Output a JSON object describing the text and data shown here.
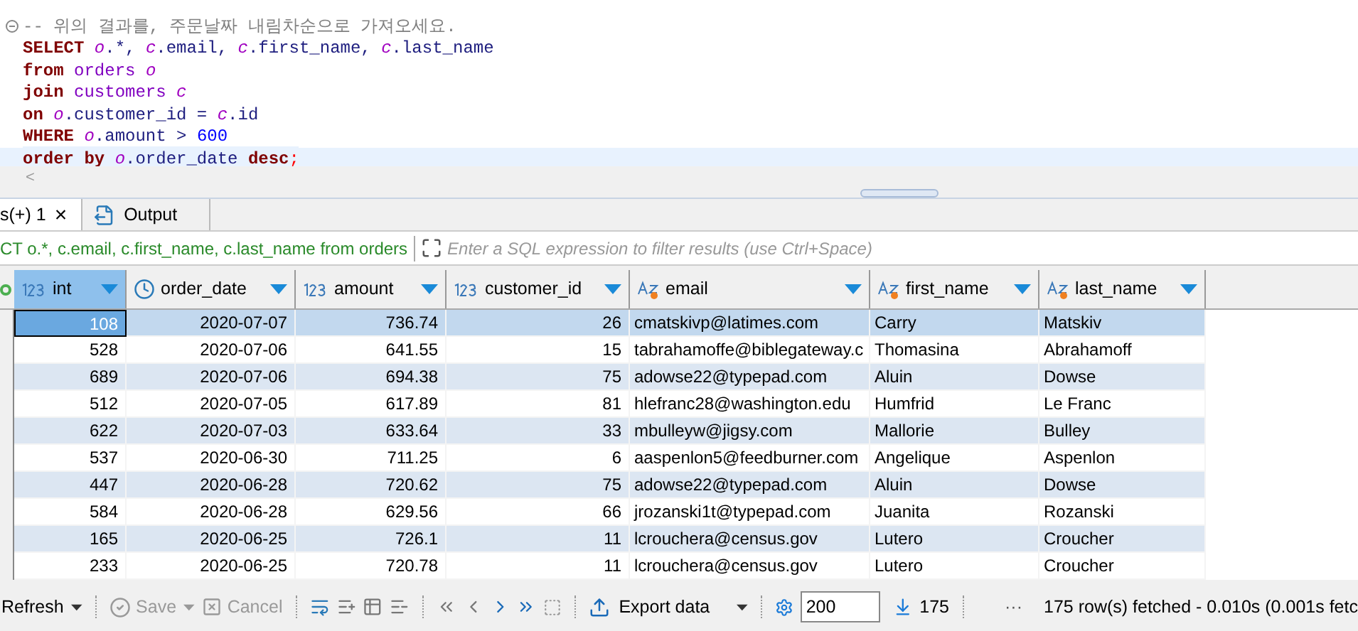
{
  "editor": {
    "lines": [
      {
        "current": false,
        "collapsible": true,
        "tokens": [
          {
            "kind": "comment",
            "text": "-- 위의 결과를, 주문날짜 내림차순으로 가져오세요."
          }
        ]
      },
      {
        "current": false,
        "collapsible": false,
        "tokens": [
          {
            "kind": "keyword",
            "text": "SELECT "
          },
          {
            "kind": "alias",
            "text": "o"
          },
          {
            "kind": "plain",
            "text": ".*, "
          },
          {
            "kind": "alias",
            "text": "c"
          },
          {
            "kind": "plain",
            "text": ".email, "
          },
          {
            "kind": "alias",
            "text": "c"
          },
          {
            "kind": "plain",
            "text": ".first_name, "
          },
          {
            "kind": "alias",
            "text": "c"
          },
          {
            "kind": "plain",
            "text": ".last_name"
          }
        ]
      },
      {
        "current": false,
        "collapsible": false,
        "tokens": [
          {
            "kind": "keyword",
            "text": "from "
          },
          {
            "kind": "table",
            "text": "orders "
          },
          {
            "kind": "alias",
            "text": "o"
          }
        ]
      },
      {
        "current": false,
        "collapsible": false,
        "tokens": [
          {
            "kind": "keyword",
            "text": "join "
          },
          {
            "kind": "table",
            "text": "customers "
          },
          {
            "kind": "alias",
            "text": "c"
          }
        ]
      },
      {
        "current": false,
        "collapsible": false,
        "tokens": [
          {
            "kind": "keyword",
            "text": "on "
          },
          {
            "kind": "alias",
            "text": "o"
          },
          {
            "kind": "plain",
            "text": ".customer_id = "
          },
          {
            "kind": "alias",
            "text": "c"
          },
          {
            "kind": "plain",
            "text": ".id"
          }
        ]
      },
      {
        "current": false,
        "collapsible": false,
        "tokens": [
          {
            "kind": "keyword",
            "text": "WHERE "
          },
          {
            "kind": "alias",
            "text": "o"
          },
          {
            "kind": "plain",
            "text": ".amount > "
          },
          {
            "kind": "number",
            "text": "600"
          }
        ]
      },
      {
        "current": true,
        "collapsible": false,
        "tokens": [
          {
            "kind": "keyword",
            "text": "order by "
          },
          {
            "kind": "alias",
            "text": "o"
          },
          {
            "kind": "plain",
            "text": ".order_date "
          },
          {
            "kind": "keyword",
            "text": "desc"
          },
          {
            "kind": "punct",
            "text": ";"
          }
        ]
      }
    ],
    "scroll_left": "<"
  },
  "tabs": [
    {
      "label": "s(+) 1",
      "close": "×",
      "selected": true,
      "kind": "results"
    },
    {
      "label": "Output",
      "selected": false,
      "kind": "output"
    }
  ],
  "filter": {
    "query": "CT o.*, c.email, c.first_name, c.last_name from orders",
    "placeholder": "Enter a SQL expression to filter results (use Ctrl+Space)"
  },
  "table": {
    "columns": [
      {
        "label": "int",
        "kind": "number",
        "selected": true
      },
      {
        "label": "order_date",
        "kind": "date",
        "selected": false
      },
      {
        "label": "amount",
        "kind": "number",
        "selected": false
      },
      {
        "label": "customer_id",
        "kind": "number",
        "selected": false
      },
      {
        "label": "email",
        "kind": "text",
        "selected": false
      },
      {
        "label": "first_name",
        "kind": "text",
        "selected": false
      },
      {
        "label": "last_name",
        "kind": "text",
        "selected": false
      }
    ],
    "rows": [
      {
        "selected": true,
        "cells": [
          "108",
          "2020-07-07",
          "736.74",
          "26",
          "cmatskivp@latimes.com",
          "Carry",
          "Matskiv"
        ]
      },
      {
        "selected": false,
        "cells": [
          "528",
          "2020-07-06",
          "641.55",
          "15",
          "tabrahamoffe@biblegateway.c",
          "Thomasina",
          "Abrahamoff"
        ]
      },
      {
        "selected": false,
        "cells": [
          "689",
          "2020-07-06",
          "694.38",
          "75",
          "adowse22@typepad.com",
          "Aluin",
          "Dowse"
        ]
      },
      {
        "selected": false,
        "cells": [
          "512",
          "2020-07-05",
          "617.89",
          "81",
          "hlefranc28@washington.edu",
          "Humfrid",
          "Le Franc"
        ]
      },
      {
        "selected": false,
        "cells": [
          "622",
          "2020-07-03",
          "633.64",
          "33",
          "mbulleyw@jigsy.com",
          "Mallorie",
          "Bulley"
        ]
      },
      {
        "selected": false,
        "cells": [
          "537",
          "2020-06-30",
          "711.25",
          "6",
          "aaspenlon5@feedburner.com",
          "Angelique",
          "Aspenlon"
        ]
      },
      {
        "selected": false,
        "cells": [
          "447",
          "2020-06-28",
          "720.62",
          "75",
          "adowse22@typepad.com",
          "Aluin",
          "Dowse"
        ]
      },
      {
        "selected": false,
        "cells": [
          "584",
          "2020-06-28",
          "629.56",
          "66",
          "jrozanski1t@typepad.com",
          "Juanita",
          "Rozanski"
        ]
      },
      {
        "selected": false,
        "cells": [
          "165",
          "2020-06-25",
          "726.1",
          "11",
          "lcrouchera@census.gov",
          "Lutero",
          "Croucher"
        ]
      },
      {
        "selected": false,
        "cells": [
          "233",
          "2020-06-25",
          "720.78",
          "11",
          "lcrouchera@census.gov",
          "Lutero",
          "Croucher"
        ]
      }
    ]
  },
  "toolbar": {
    "refresh": "Refresh",
    "save": {
      "label": "Save",
      "disabled": true
    },
    "cancel": {
      "label": "Cancel",
      "disabled": true
    },
    "export": "Export data",
    "fetch_size": "200",
    "row_count": "175",
    "more": "···",
    "status": "175 row(s) fetched - 0.010s (0.001s fetc"
  }
}
